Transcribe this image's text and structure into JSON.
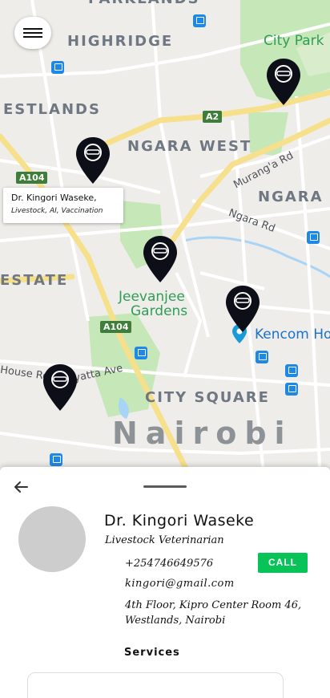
{
  "map": {
    "area_labels": {
      "parklands": "PARKLANDS",
      "highridge": "HIGHRIDGE",
      "westlands": "ESTLANDS",
      "ngara_west": "NGARA WEST",
      "ngara": "NGARA",
      "estate": "ESTATE",
      "city_square": "CITY SQUARE"
    },
    "city_label": "Nairobi",
    "road_labels": {
      "murangа_rd": "Murang'a Rd",
      "ngara_rd": "Ngara Rd",
      "kenyatta_ave": "yatta Ave",
      "house_rd": "House Ro"
    },
    "poi_labels": {
      "city_park": "City Park",
      "jeevanjee_line1": "Jeevanjee",
      "jeevanjee_line2": "Gardens",
      "kencom": "Kencom Ho"
    },
    "shields": {
      "a2": "A2",
      "a104_top": "A104",
      "a104_bottom": "A104"
    },
    "info_window": {
      "name": "Dr. Kingori Waseke,",
      "services": "Livestock, AI, Vaccination"
    },
    "pins": [
      {
        "name": "vet-pin-1"
      },
      {
        "name": "vet-pin-2"
      },
      {
        "name": "vet-pin-3"
      },
      {
        "name": "vet-pin-4"
      },
      {
        "name": "vet-pin-5"
      }
    ],
    "colors": {
      "pin": "#0d0f18",
      "park": "#c6e7b8",
      "road_major": "#f7e08c",
      "water": "#a8d4f5"
    }
  },
  "vet": {
    "name": "Dr. Kingori Waseke",
    "title": "Livestock Veterinarian",
    "phone": "+254746649576",
    "call_label": "CALL",
    "email": "kingori@gmail.com",
    "address": "4th Floor, Kipro Center Room 46, Westlands, Nairobi",
    "services_heading": "Services"
  },
  "colors": {
    "call_button": "#08c358",
    "avatar": "#cdcdcd"
  }
}
